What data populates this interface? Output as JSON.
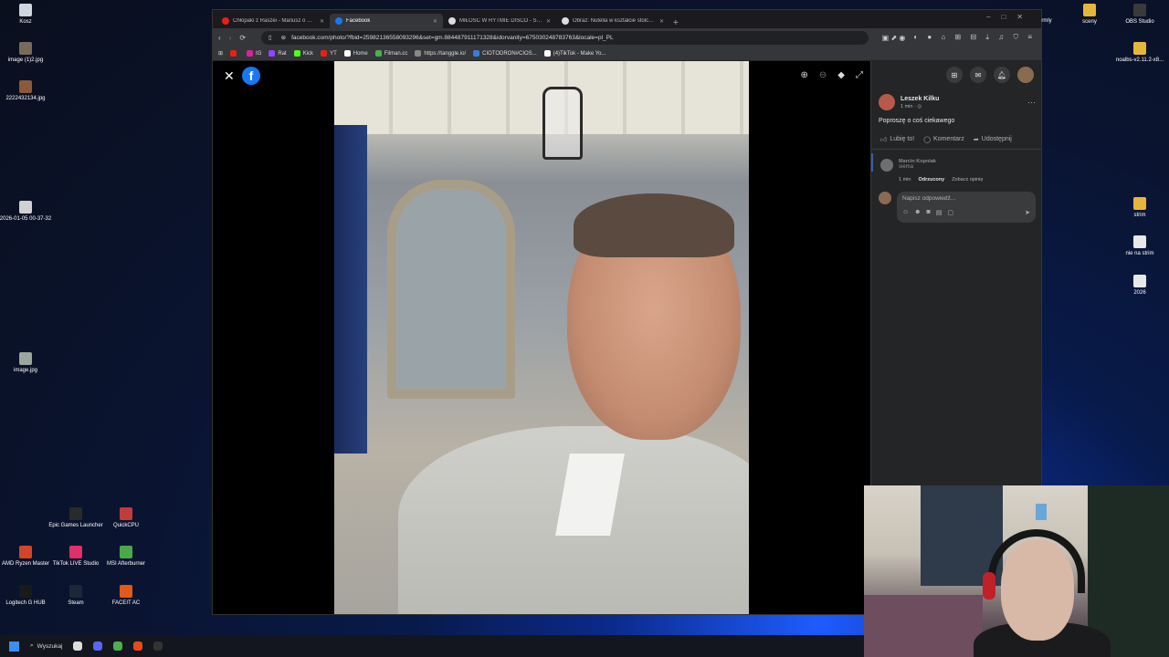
{
  "desktop": {
    "left_icons": [
      {
        "label": "Kosz",
        "color": "#cfd6e0"
      },
      {
        "label": "image (1)2.jpg",
        "color": "#7a6a5a"
      },
      {
        "label": "2222432134.jpg",
        "color": "#8a5a3a"
      },
      {
        "label": "2026-01-05 00-37-32",
        "color": "#d0d0d0"
      },
      {
        "label": "image.jpg",
        "color": "#9aa79a"
      }
    ],
    "bottom_icons": [
      {
        "label": "Epic Games Launcher",
        "color": "#2a2a2a"
      },
      {
        "label": "QuickCPU",
        "color": "#c23b3b"
      },
      {
        "label": "AMD Ryzen Master",
        "color": "#d2452b"
      },
      {
        "label": "TikTok LIVE Studio",
        "color": "#e0306a"
      },
      {
        "label": "MSI Afterburner",
        "color": "#4aa84a"
      },
      {
        "label": "Logitech G HUB",
        "color": "#1a1a1a"
      },
      {
        "label": "Steam",
        "color": "#1b2838"
      },
      {
        "label": "FACEIT AC",
        "color": "#e05a1a"
      }
    ],
    "right_icons": [
      {
        "label": "sceny",
        "color": "#e6b63a"
      },
      {
        "label": "OBS Studio",
        "color": "#3a3a3a"
      },
      {
        "label": "noalbs-v2.11.2-x8...",
        "color": "#e6b63a"
      },
      {
        "label": "strim",
        "color": "#e6b63a"
      },
      {
        "label": "nie na strim",
        "color": "#e8e8e8"
      },
      {
        "label": "2026",
        "color": "#e8e8e8"
      }
    ],
    "top_fragment": "rmly"
  },
  "browser": {
    "tabs": [
      {
        "title": "Chłopaki z Raszei - Mariusz o wszystk",
        "favicon": "youtube-icon",
        "color": "#e62117",
        "active": false
      },
      {
        "title": "Facebook",
        "favicon": "facebook-icon",
        "color": "#1877f2",
        "active": true
      },
      {
        "title": "MIŁOŚĆ W RYTMIE DISCO - Szukaj w",
        "favicon": "google-icon",
        "color": "#dddddd",
        "active": false
      },
      {
        "title": "Obraz: Nutella w kształcie stolca na",
        "favicon": "chatgpt-icon",
        "color": "#dddddd",
        "active": false
      }
    ],
    "new_tab": "+",
    "window_controls": "–□✕",
    "url": "facebook.com/photo/?fbid=25982136558093296&set=gm.884487911171328&idorvanity=675030248783763&locale=pl_PL",
    "bookmarks": [
      {
        "label": "",
        "color": "#e62117"
      },
      {
        "label": "IG",
        "color": "#d6249f"
      },
      {
        "label": "Rat",
        "color": "#9146ff"
      },
      {
        "label": "Kick",
        "color": "#53fc18"
      },
      {
        "label": "YT",
        "color": "#e62117"
      },
      {
        "label": "Home",
        "color": "#ffffff"
      },
      {
        "label": "Filman.cc",
        "color": "#4caf50"
      },
      {
        "label": "https://tanggle.io/",
        "color": "#888888"
      },
      {
        "label": "CIOTODRON#CIOS...",
        "color": "#3b7dd8"
      },
      {
        "label": "(4)TikTok - Make Yo...",
        "color": "#ffffff"
      }
    ]
  },
  "viewer": {
    "close": "✕",
    "logo": "f",
    "tools": [
      "⊕",
      "⊖",
      "◆",
      "⤢"
    ]
  },
  "post": {
    "author": "Leszek Kilku",
    "meta": "1 min · ◎",
    "text": "Poproszę o coś ciekawego",
    "more": "···",
    "actions": {
      "like": "Lubię to!",
      "comment": "Komentarz",
      "share": "Udostępnij"
    },
    "comment": {
      "author": "Marcin Kopniak",
      "text": "siema",
      "time": "1 min",
      "status": "Odrzucony",
      "view": "Zobacz opinię"
    },
    "reply_placeholder": "Napisz odpowiedź..."
  },
  "taskbar": {
    "search_label": "Wyszukaj",
    "apps": [
      "#dddddd",
      "#5865f2",
      "#4caf50",
      "#e64a19",
      "#333333"
    ]
  }
}
